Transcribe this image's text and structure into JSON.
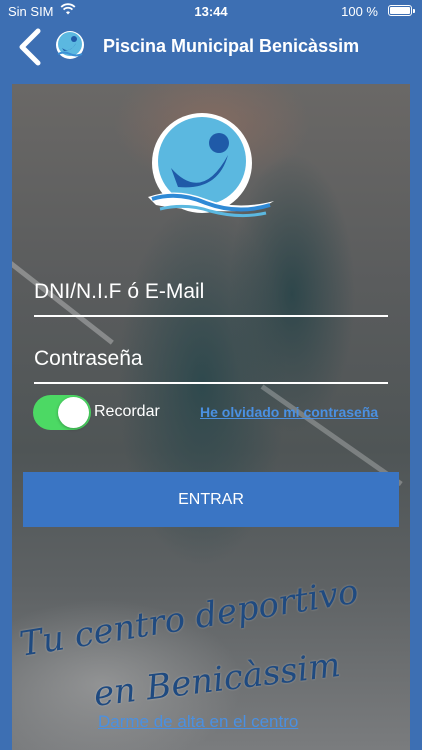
{
  "status_bar": {
    "carrier": "Sin SIM",
    "time": "13:44",
    "battery_pct": "100 %"
  },
  "header": {
    "title": "Piscina Municipal Benicàssim",
    "back_icon": "chevron-left-icon",
    "logo_icon": "swimmer-logo-icon"
  },
  "login": {
    "user_placeholder": "DNI/N.I.F ó E-Mail",
    "password_placeholder": "Contraseña",
    "remember_label": "Recordar",
    "remember_on": true,
    "forgot_link": "He olvidado mi contraseña",
    "submit_label": "ENTRAR"
  },
  "slogan": {
    "line1": "Tu centro deportivo",
    "line2": "en Benicàssim"
  },
  "signup_link": "Darme de alta en el centro",
  "colors": {
    "header_bg": "#3d6fb3",
    "button_bg": "#3a75c4",
    "link": "#4a90e2",
    "toggle_on": "#4cd964"
  }
}
